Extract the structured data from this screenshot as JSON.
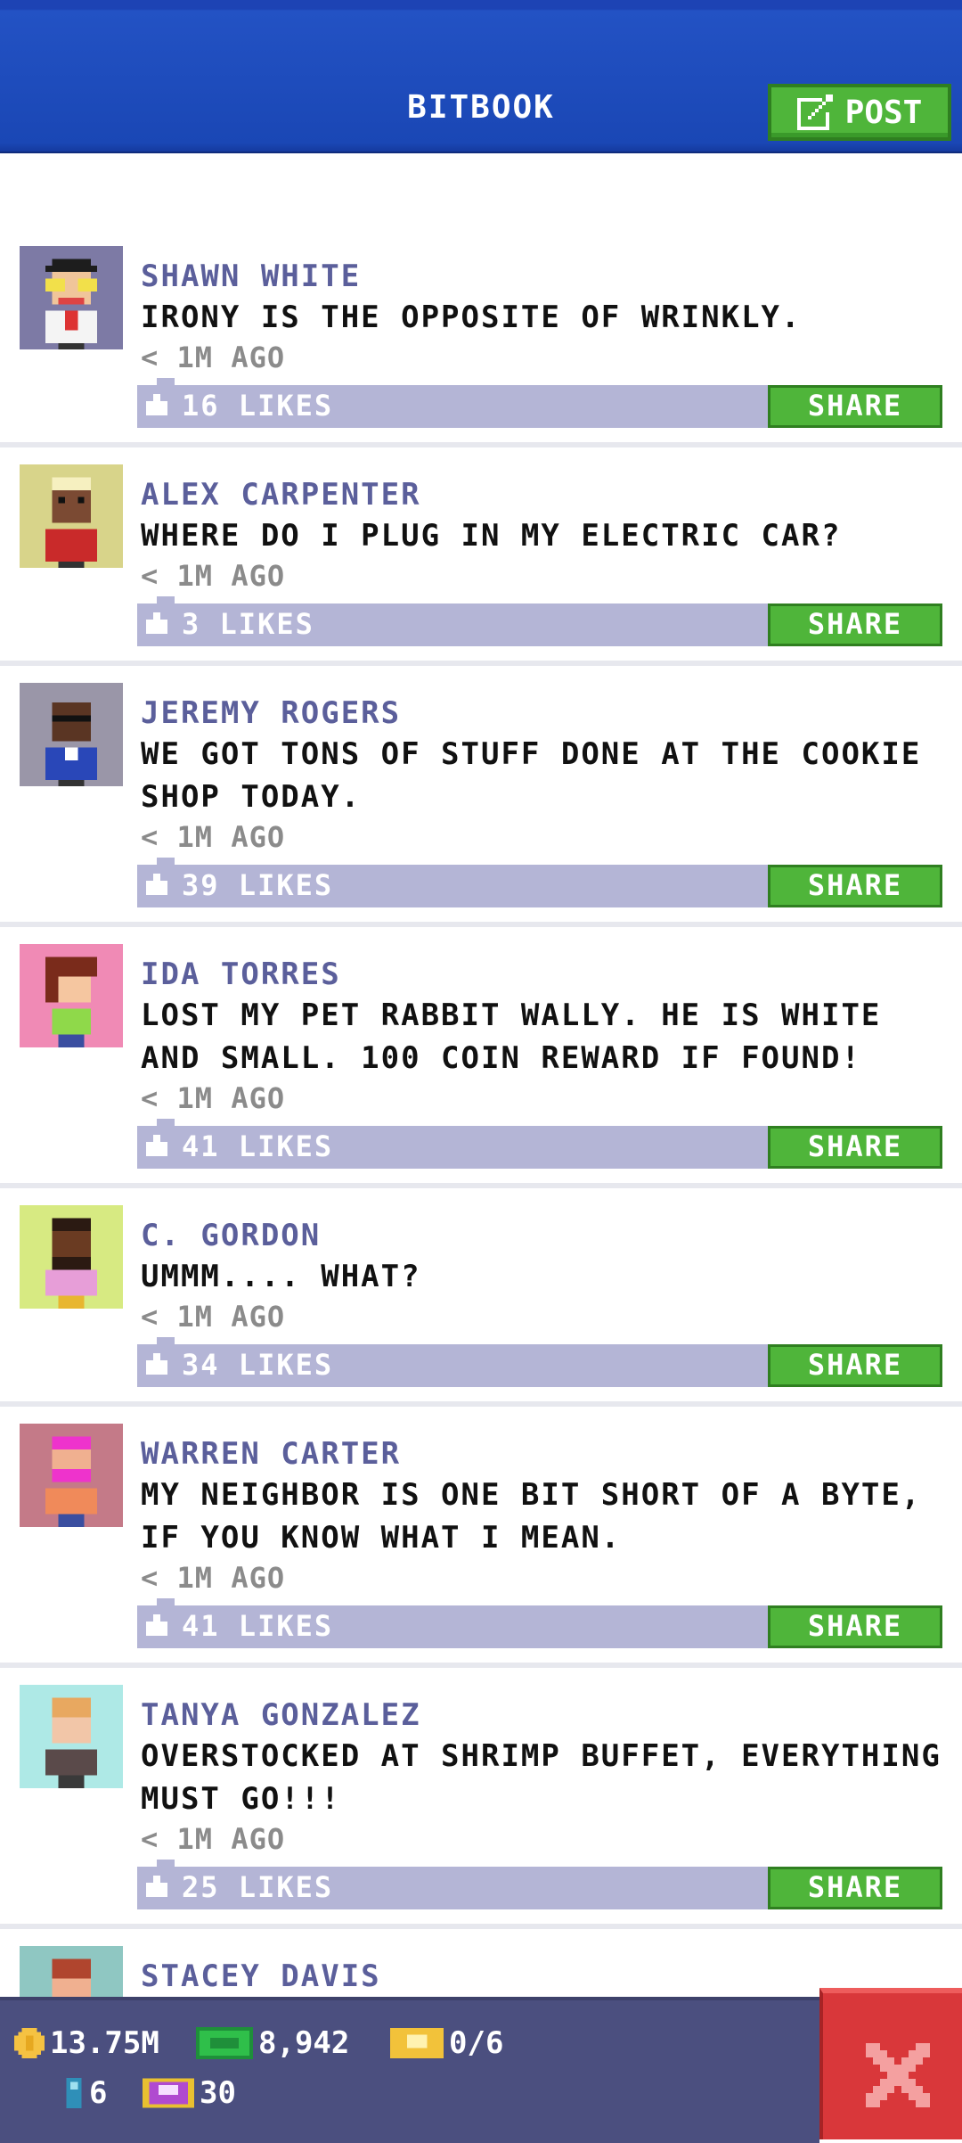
{
  "header": {
    "title": "BITBOOK",
    "post_label": "POST"
  },
  "posts": [
    {
      "author": "SHAWN WHITE",
      "message": "IRONY IS THE OPPOSITE OF WRINKLY.",
      "time": "< 1M AGO",
      "likes": "16 LIKES",
      "share": "SHARE",
      "avatar_bg": "#7d7aa5"
    },
    {
      "author": "ALEX CARPENTER",
      "message": "WHERE DO I PLUG IN MY ELECTRIC CAR?",
      "time": "< 1M AGO",
      "likes": "3 LIKES",
      "share": "SHARE",
      "avatar_bg": "#d8d48a"
    },
    {
      "author": "JEREMY ROGERS",
      "message": "WE GOT TONS OF STUFF DONE AT THE COOKIE SHOP TODAY.",
      "time": "< 1M AGO",
      "likes": "39 LIKES",
      "share": "SHARE",
      "avatar_bg": "#9a96a8"
    },
    {
      "author": "IDA TORRES",
      "message": "LOST MY PET RABBIT WALLY. HE IS WHITE AND SMALL. 100 COIN REWARD IF FOUND!",
      "time": "< 1M AGO",
      "likes": "41 LIKES",
      "share": "SHARE",
      "avatar_bg": "#f08ab5"
    },
    {
      "author": "C. GORDON",
      "message": "UMMM....  WHAT?",
      "time": "< 1M AGO",
      "likes": "34 LIKES",
      "share": "SHARE",
      "avatar_bg": "#d7ea82"
    },
    {
      "author": "WARREN CARTER",
      "message": "MY NEIGHBOR IS ONE BIT SHORT OF A BYTE, IF YOU KNOW WHAT I MEAN.",
      "time": "< 1M AGO",
      "likes": "41 LIKES",
      "share": "SHARE",
      "avatar_bg": "#c47a88"
    },
    {
      "author": "TANYA GONZALEZ",
      "message": "OVERSTOCKED AT SHRIMP BUFFET, EVERYTHING MUST GO!!!",
      "time": "< 1M AGO",
      "likes": "25 LIKES",
      "share": "SHARE",
      "avatar_bg": "#aee9e6"
    },
    {
      "author": "STACEY DAVIS",
      "avatar_bg": "#8fc7c2"
    }
  ],
  "status": {
    "coins": "13.75M",
    "bux": "8,942",
    "tickets": "0/6",
    "bitizens": "6",
    "gems": "30"
  }
}
